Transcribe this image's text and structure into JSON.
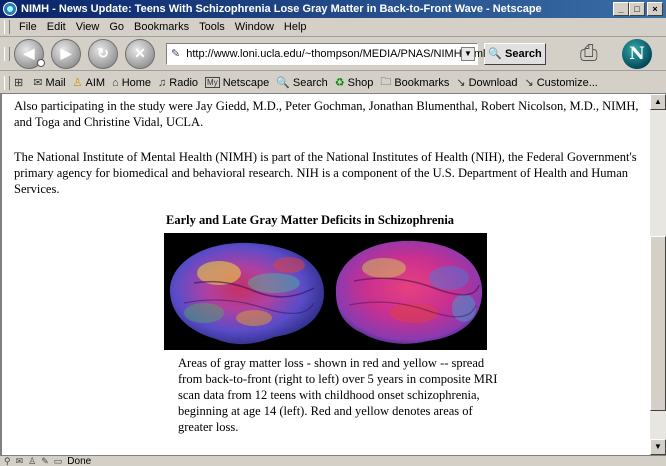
{
  "window": {
    "title": "NIMH - News Update: Teens With Schizophrenia Lose Gray Matter in Back-to-Front Wave - Netscape",
    "controls": {
      "minimize": "_",
      "maximize": "□",
      "close": "×"
    }
  },
  "menu": {
    "items": [
      "File",
      "Edit",
      "View",
      "Go",
      "Bookmarks",
      "Tools",
      "Window",
      "Help"
    ]
  },
  "nav": {
    "url": "http://www.loni.ucla.edu/~thompson/MEDIA/PNAS/NIMH.html",
    "search_label": "Search"
  },
  "personal_toolbar": {
    "items": [
      {
        "icon": "home-tab-icon",
        "label": ""
      },
      {
        "icon": "mail-icon",
        "label": "Mail"
      },
      {
        "icon": "aim-icon",
        "label": "AIM"
      },
      {
        "icon": "home-icon",
        "label": "Home"
      },
      {
        "icon": "radio-icon",
        "label": "Radio"
      },
      {
        "icon": "my-netscape-icon",
        "label": "Netscape"
      },
      {
        "icon": "search-icon",
        "label": "Search"
      },
      {
        "icon": "shop-icon",
        "label": "Shop"
      },
      {
        "icon": "bookmarks-folder-icon",
        "label": "Bookmarks"
      },
      {
        "icon": "download-icon",
        "label": "Download"
      },
      {
        "icon": "customize-icon",
        "label": "Customize..."
      }
    ]
  },
  "content": {
    "paragraph1": "Also participating in the study were Jay Giedd, M.D., Peter Gochman, Jonathan Blumenthal, Robert Nicolson, M.D., NIMH, and Toga and Christine Vidal, UCLA.",
    "paragraph2": "The National Institute of Mental Health (NIMH) is part of the National Institutes of Health (NIH), the Federal Government's primary agency for biomedical and behavioral research. NIH is a component of the U.S. Department of Health and Human Services.",
    "figure_title": "Early and Late Gray Matter Deficits in Schizophrenia",
    "caption": "Areas of gray matter loss - shown in red and yellow -- spread from back-to-front (right to left) over 5 years in composite MRI scan data from 12 teens with childhood onset schizophrenia, beginning at age 14 (left). Red and yellow denotes areas of greater loss."
  },
  "status": {
    "text": "Done"
  },
  "colors": {
    "titlebar_start": "#0a246a",
    "titlebar_end": "#3a6ea5",
    "chrome": "#d4d0c8"
  }
}
